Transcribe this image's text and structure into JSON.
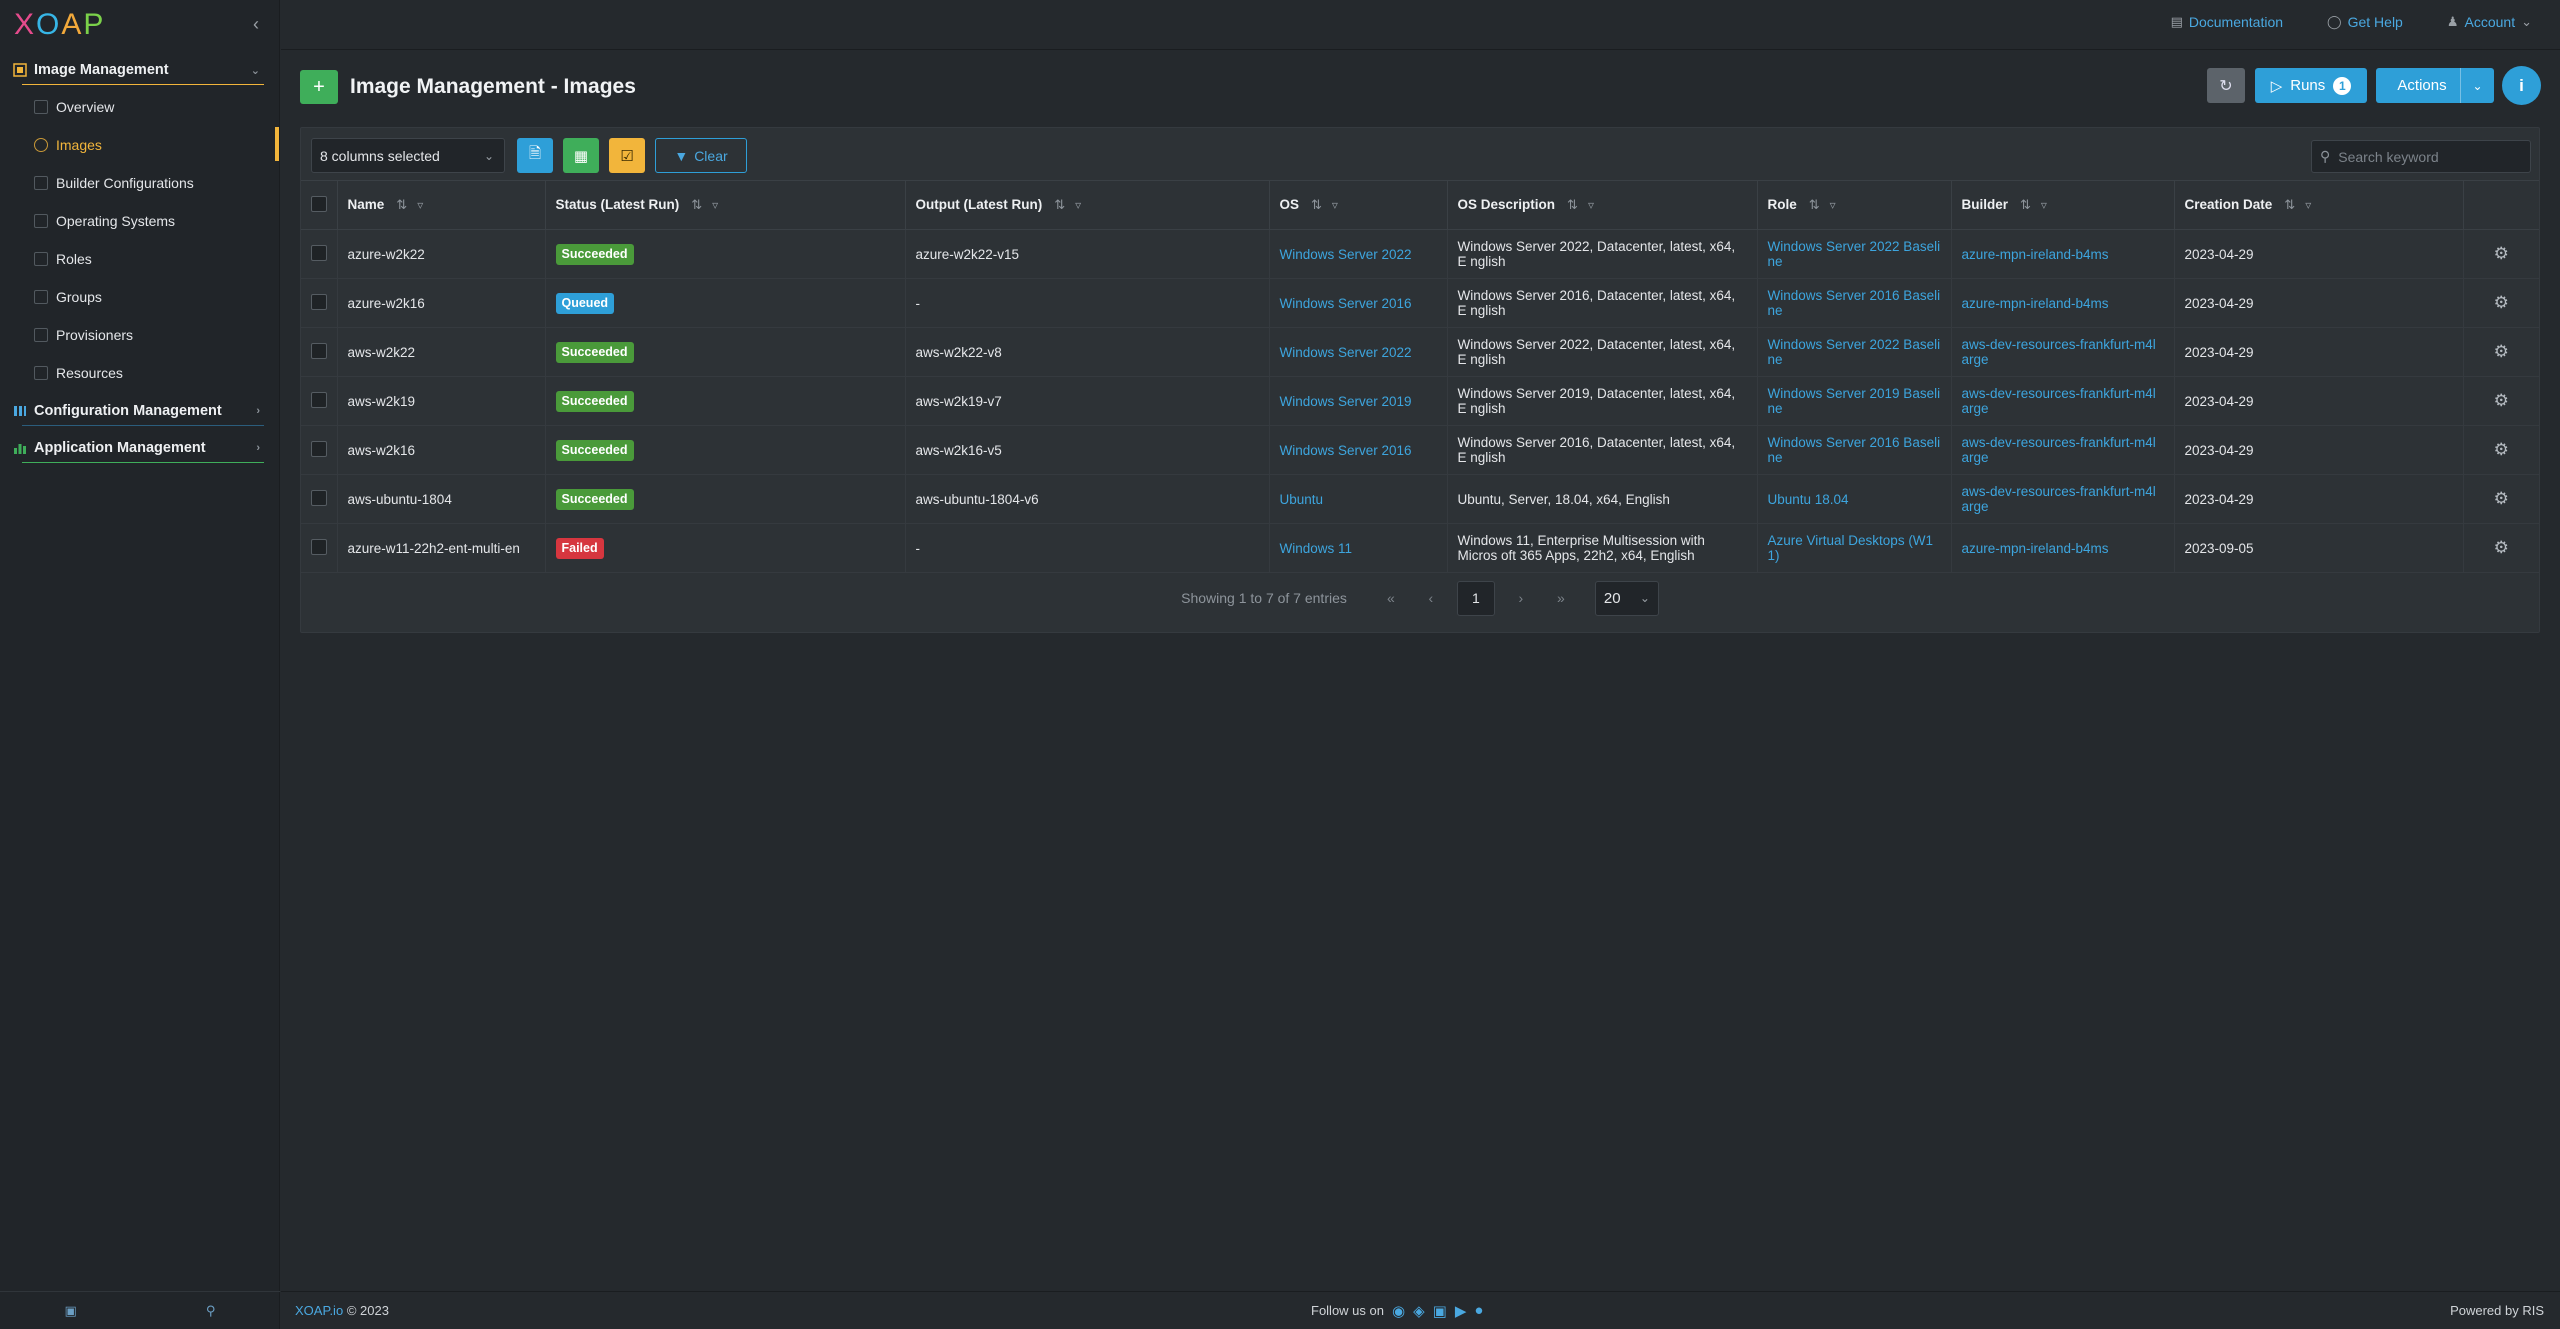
{
  "app": {
    "logo": "XOAP"
  },
  "sidebar": {
    "sections": [
      {
        "label": "Image Management",
        "color": "#f2b53b"
      },
      {
        "label": "Configuration Management",
        "color": "#4aa8e0"
      },
      {
        "label": "Application Management",
        "color": "#3fae5a"
      }
    ],
    "items": [
      {
        "label": "Overview"
      },
      {
        "label": "Images",
        "active": true
      },
      {
        "label": "Builder Configurations"
      },
      {
        "label": "Operating Systems"
      },
      {
        "label": "Roles"
      },
      {
        "label": "Groups"
      },
      {
        "label": "Provisioners"
      },
      {
        "label": "Resources"
      }
    ]
  },
  "topbar": {
    "documentation": "Documentation",
    "help": "Get Help",
    "account": "Account"
  },
  "header": {
    "title": "Image Management - Images",
    "runs_label": "Runs",
    "runs_count": "1",
    "actions_label": "Actions",
    "info_label": "i"
  },
  "toolbar": {
    "columns_selected": "8 columns selected",
    "clear_label": "Clear",
    "search_placeholder": "Search keyword"
  },
  "table": {
    "columns": [
      "Name",
      "Status (Latest Run)",
      "Output (Latest Run)",
      "OS",
      "OS Description",
      "Role",
      "Builder",
      "Creation Date"
    ],
    "rows": [
      {
        "name": "azure-w2k22",
        "status": "Succeeded",
        "status_kind": "succeeded",
        "output": "azure-w2k22-v15",
        "os": "Windows Server 2022",
        "os_desc": "Windows Server 2022, Datacenter, latest, x64, E nglish",
        "role": "Windows Server 2022 Baseli ne",
        "builder": "azure-mpn-ireland-b4ms",
        "date": "2023-04-29"
      },
      {
        "name": "azure-w2k16",
        "status": "Queued",
        "status_kind": "queued",
        "output": "-",
        "os": "Windows Server 2016",
        "os_desc": "Windows Server 2016, Datacenter, latest, x64, E nglish",
        "role": "Windows Server 2016 Baseli ne",
        "builder": "azure-mpn-ireland-b4ms",
        "date": "2023-04-29"
      },
      {
        "name": "aws-w2k22",
        "status": "Succeeded",
        "status_kind": "succeeded",
        "output": "aws-w2k22-v8",
        "os": "Windows Server 2022",
        "os_desc": "Windows Server 2022, Datacenter, latest, x64, E nglish",
        "role": "Windows Server 2022 Baseli ne",
        "builder": "aws-dev-resources-frankfurt-m4l arge",
        "date": "2023-04-29"
      },
      {
        "name": "aws-w2k19",
        "status": "Succeeded",
        "status_kind": "succeeded",
        "output": "aws-w2k19-v7",
        "os": "Windows Server 2019",
        "os_desc": "Windows Server 2019, Datacenter, latest, x64, E nglish",
        "role": "Windows Server 2019 Baseli ne",
        "builder": "aws-dev-resources-frankfurt-m4l arge",
        "date": "2023-04-29"
      },
      {
        "name": "aws-w2k16",
        "status": "Succeeded",
        "status_kind": "succeeded",
        "output": "aws-w2k16-v5",
        "os": "Windows Server 2016",
        "os_desc": "Windows Server 2016, Datacenter, latest, x64, E nglish",
        "role": "Windows Server 2016 Baseli ne",
        "builder": "aws-dev-resources-frankfurt-m4l arge",
        "date": "2023-04-29"
      },
      {
        "name": "aws-ubuntu-1804",
        "status": "Succeeded",
        "status_kind": "succeeded",
        "output": "aws-ubuntu-1804-v6",
        "os": "Ubuntu",
        "os_desc": "Ubuntu, Server, 18.04, x64, English",
        "role": "Ubuntu 18.04",
        "builder": "aws-dev-resources-frankfurt-m4l arge",
        "date": "2023-04-29"
      },
      {
        "name": "azure-w11-22h2-ent-multi-en",
        "status": "Failed",
        "status_kind": "failed",
        "output": "-",
        "os": "Windows 11",
        "os_desc": "Windows 11, Enterprise Multisession with Micros oft 365 Apps, 22h2, x64, English",
        "role": "Azure Virtual Desktops (W1 1)",
        "builder": "azure-mpn-ireland-b4ms",
        "date": "2023-09-05"
      }
    ]
  },
  "pagination": {
    "info": "Showing 1 to 7 of 7 entries",
    "current_page": "1",
    "page_size": "20"
  },
  "footer": {
    "brand": "XOAP.io",
    "copyright": "© 2023",
    "follow": "Follow us on",
    "powered": "Powered by RIS"
  },
  "colors": {
    "accent": "#2e9fd8",
    "success": "#4a9a3a",
    "danger": "#d6363f",
    "warning": "#f2b53b",
    "background": "#25292d"
  }
}
